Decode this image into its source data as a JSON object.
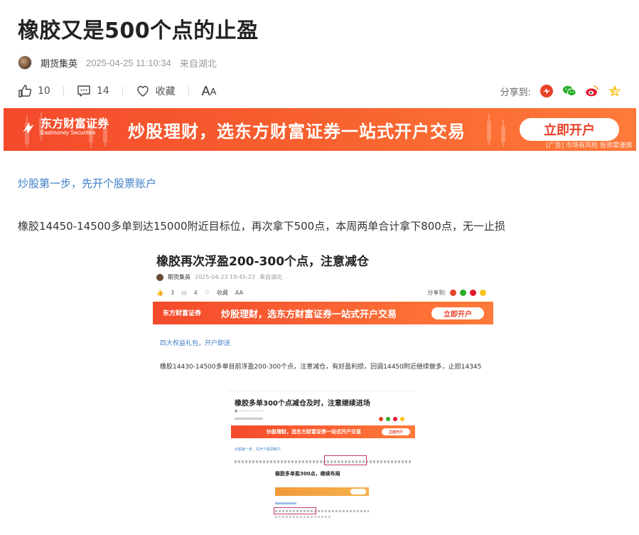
{
  "article": {
    "title": "橡胶又是500个点的止盈",
    "author": "期货集英",
    "time": "2025-04-25 11:10:34",
    "location": "来自湖北"
  },
  "actions": {
    "likes": "10",
    "comments": "14",
    "favorite_label": "收藏",
    "font_size_label_big": "A",
    "font_size_label_small": "A",
    "share_label": "分享到:",
    "share_targets": [
      "wechat-moments",
      "wechat",
      "weibo",
      "qzone"
    ]
  },
  "banner": {
    "brand_cn": "东方财富证券",
    "brand_en": "Eastmoney Securities",
    "slogan": "炒股理财，选东方财富证券一站式开户交易",
    "button": "立即开户",
    "ad_tag": "[广告] 市场有风险 投资需谨慎"
  },
  "content": {
    "link": "炒股第一步，先开个股票账户",
    "paragraph": "橡胶14450-14500多单到达15000附近目标位，再次拿下500点，本周两单合计拿下800点，无一止损"
  },
  "embedded": {
    "title": "橡胶再次浮盈200-300个点，注意减仓",
    "author": "期货集英",
    "time": "2025-04-23 19:45:23",
    "location": "来自湖北",
    "likes": "3",
    "comments": "4",
    "favorite_label": "收藏",
    "share_label": "分享到:",
    "banner_brand": "东方财富证券",
    "banner_slogan": "炒股理财，选东方财富证券一站式开户交易",
    "banner_button": "立即开户",
    "link": "四大权益礼包，开户即送",
    "paragraph": "橡胶14430-14500多单目前浮盈200-300个点，注意减仓，有好盈利损，回调14450附近继续做多，止损14345",
    "nested_title": "橡胶多单300个点减仓及时，注意继续进场",
    "nested_banner_slogan": "炒股理财，选东方财富证券一站式开户交易",
    "nested_button": "立即开户",
    "nested_link": "炒股第一步，先开个股票账户",
    "nested2_title": "橡胶多单盈300点，继续布局"
  },
  "colors": {
    "banner_start": "#f44a2c",
    "banner_end": "#ff7a3a",
    "link": "#3f7ec7",
    "highlight_box": "#c2366a"
  }
}
